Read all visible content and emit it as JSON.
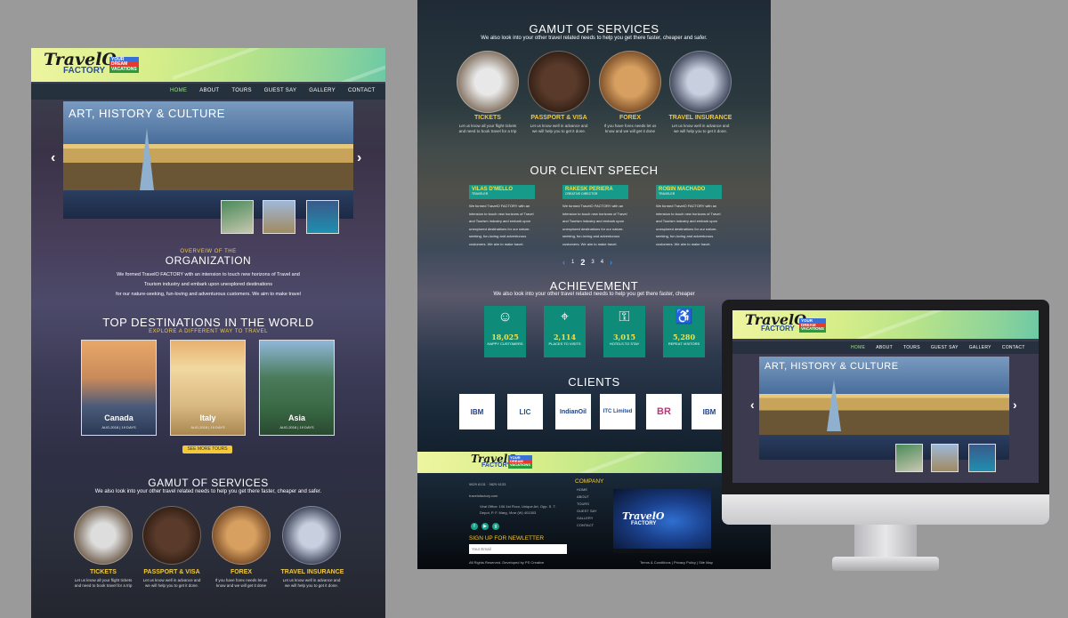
{
  "brand": {
    "logo_main": "TravelO",
    "logo_sub": "FACTORY",
    "tag1": "YOUR",
    "tag2": "DREAM",
    "tag3": "VACATIONS"
  },
  "nav": [
    "HOME",
    "ABOUT",
    "TOURS",
    "GUEST SAY",
    "GALLERY",
    "CONTACT"
  ],
  "slider": {
    "title": "ART, HISTORY & CULTURE",
    "prev": "‹",
    "next": "›"
  },
  "about": {
    "kicker": "OVERVEIW OF THE",
    "title": "ORGANIZATION",
    "lines": [
      "We formed TravelO FACTORY with an intension to touch new horizons of Travel and",
      "Tourism industry and embark upon unexplored destinations",
      "for our nature-seeking, fun-loving and adventurous customers. We aim to make travel"
    ]
  },
  "destinations": {
    "title": "TOP DESTINATIONS IN THE WORLD",
    "sub": "EXPLORE A DIFFERENT WAY TO TRAVEL",
    "items": [
      {
        "name": "Canada",
        "date": "AUG-2018 | 19 DAYS"
      },
      {
        "name": "Italy",
        "date": "AUG-2018 | 19 DAYS"
      },
      {
        "name": "Asia",
        "date": "AUG-2018 | 19 DAYS"
      }
    ],
    "button": "SEE MORE TOURS"
  },
  "services": {
    "title": "GAMUT OF SERVICES",
    "sub": "We also look into your other travel related needs to help you get there faster, cheaper and safer.",
    "items": [
      {
        "name": "TICKETS",
        "desc": "Let us know all your flight tickets and need to book travel for a trip"
      },
      {
        "name": "PASSPORT & VISA",
        "desc": "Let us know well in advance and we will help you to get it done."
      },
      {
        "name": "FOREX",
        "desc": "If you have forex needs let us know and we will get it done"
      },
      {
        "name": "TRAVEL INSURANCE",
        "desc": "Let us know well in advance and we will help you to get it done."
      }
    ]
  },
  "testimonials": {
    "title": "OUR CLIENT SPEECH",
    "items": [
      {
        "name": "VILAS D'MELLO",
        "role": "TRAVELER"
      },
      {
        "name": "RAKESK PERIERA",
        "role": "CREATIVE DIRECTOR"
      },
      {
        "name": "ROBIN MACHADO",
        "role": "TRAVELER"
      }
    ],
    "text": "We formed TravelO FACTORY with an intension to touch new horizons of Travel and Tourism industry and embark upon unexplored destinations for our nature-seeking, fun-loving and adventurous customers. We aim to make travel.",
    "pager": [
      "‹",
      "1",
      "2",
      "3",
      "4",
      "›"
    ]
  },
  "achievement": {
    "title": "ACHIEVEMENT",
    "sub": "We also look into your other travel related needs to help you get there faster, cheaper",
    "items": [
      {
        "icon": "☺",
        "num": "18,025",
        "label": "HAPPY CUSTOMERS"
      },
      {
        "icon": "⌖",
        "num": "2,114",
        "label": "PLACES TO VISITS"
      },
      {
        "icon": "⚿",
        "num": "3,015",
        "label": "HOTELS TO STAY"
      },
      {
        "icon": "♿",
        "num": "5,280",
        "label": "REPEAT VISITORS"
      }
    ]
  },
  "clients": {
    "title": "CLIENTS",
    "items": [
      "IBM",
      "LIC",
      "IndianOil",
      "ITC Limited",
      "BR",
      "IBM"
    ]
  },
  "footer": {
    "company_title": "COMPANY",
    "links": [
      "HOME",
      "ABOUT",
      "TOURS",
      "GUEST SAY",
      "GALLERY",
      "CONTACT"
    ],
    "phone": "9829 6131 · 9829 6133",
    "email": "travelofactory.com",
    "address": "Viral Office: 106 1st Floor, Unique Art, Opp. S. T. Depot, P. F. Marg, Virar (W) 401303",
    "news_title": "SIGN UP FOR NEWLETTER",
    "news_placeholder": "Your Email",
    "copyright": "All Rights Reserved. Developed by PS Creative",
    "legal": "Terms & Conditions | Privacy Policy | Site Map"
  },
  "colors": {
    "accent": "#f3c93a",
    "teal": "#0f8b7a",
    "nav_active": "#9de88a"
  }
}
